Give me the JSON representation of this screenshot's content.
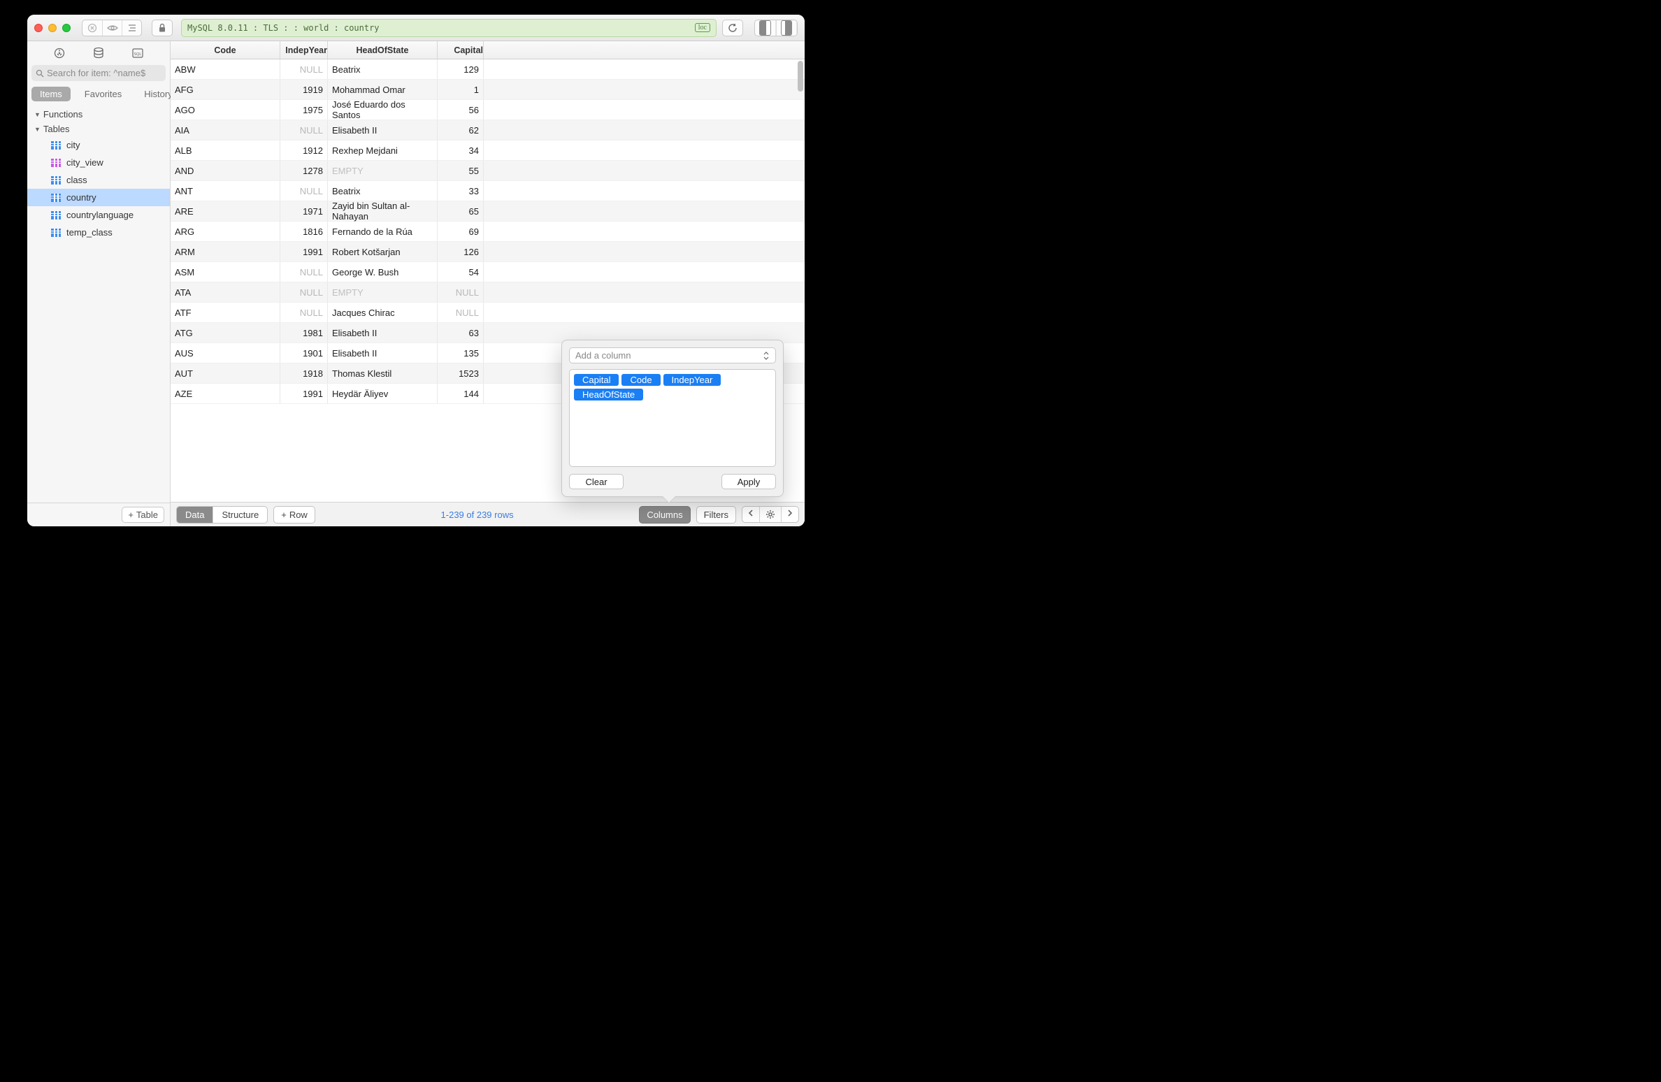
{
  "titlebar": {
    "connection": "MySQL 8.0.11 : TLS :  : world : country",
    "badge": "loc"
  },
  "sidebar": {
    "search_placeholder": "Search for item: ^name$",
    "tabs": {
      "items": "Items",
      "favorites": "Favorites",
      "history": "History"
    },
    "functions_label": "Functions",
    "tables_label": "Tables",
    "tables": [
      {
        "name": "city",
        "type": "table"
      },
      {
        "name": "city_view",
        "type": "view"
      },
      {
        "name": "class",
        "type": "table"
      },
      {
        "name": "country",
        "type": "table",
        "selected": true
      },
      {
        "name": "countrylanguage",
        "type": "table"
      },
      {
        "name": "temp_class",
        "type": "table"
      }
    ],
    "add_table": "Table"
  },
  "table": {
    "columns": [
      "Code",
      "IndepYear",
      "HeadOfState",
      "Capital"
    ],
    "rows": [
      {
        "code": "ABW",
        "indep": null,
        "head": "Beatrix",
        "cap": "129"
      },
      {
        "code": "AFG",
        "indep": "1919",
        "head": "Mohammad Omar",
        "cap": "1"
      },
      {
        "code": "AGO",
        "indep": "1975",
        "head": "José Eduardo dos Santos",
        "cap": "56"
      },
      {
        "code": "AIA",
        "indep": null,
        "head": "Elisabeth II",
        "cap": "62"
      },
      {
        "code": "ALB",
        "indep": "1912",
        "head": "Rexhep Mejdani",
        "cap": "34"
      },
      {
        "code": "AND",
        "indep": "1278",
        "head": "",
        "cap": "55"
      },
      {
        "code": "ANT",
        "indep": null,
        "head": "Beatrix",
        "cap": "33"
      },
      {
        "code": "ARE",
        "indep": "1971",
        "head": "Zayid bin Sultan al-Nahayan",
        "cap": "65"
      },
      {
        "code": "ARG",
        "indep": "1816",
        "head": "Fernando de la Rúa",
        "cap": "69"
      },
      {
        "code": "ARM",
        "indep": "1991",
        "head": "Robert Kotšarjan",
        "cap": "126"
      },
      {
        "code": "ASM",
        "indep": null,
        "head": "George W. Bush",
        "cap": "54"
      },
      {
        "code": "ATA",
        "indep": null,
        "head": "",
        "cap": null
      },
      {
        "code": "ATF",
        "indep": null,
        "head": "Jacques Chirac",
        "cap": null
      },
      {
        "code": "ATG",
        "indep": "1981",
        "head": "Elisabeth II",
        "cap": "63"
      },
      {
        "code": "AUS",
        "indep": "1901",
        "head": "Elisabeth II",
        "cap": "135"
      },
      {
        "code": "AUT",
        "indep": "1918",
        "head": "Thomas Klestil",
        "cap": "1523"
      },
      {
        "code": "AZE",
        "indep": "1991",
        "head": "Heydär Äliyev",
        "cap": "144"
      }
    ],
    "null_text": "NULL",
    "empty_text": "EMPTY"
  },
  "footer": {
    "data": "Data",
    "structure": "Structure",
    "add_row": "Row",
    "count": "1-239 of 239 rows",
    "columns": "Columns",
    "filters": "Filters"
  },
  "popover": {
    "placeholder": "Add a column",
    "tags": [
      "Capital",
      "Code",
      "IndepYear",
      "HeadOfState"
    ],
    "clear": "Clear",
    "apply": "Apply"
  }
}
